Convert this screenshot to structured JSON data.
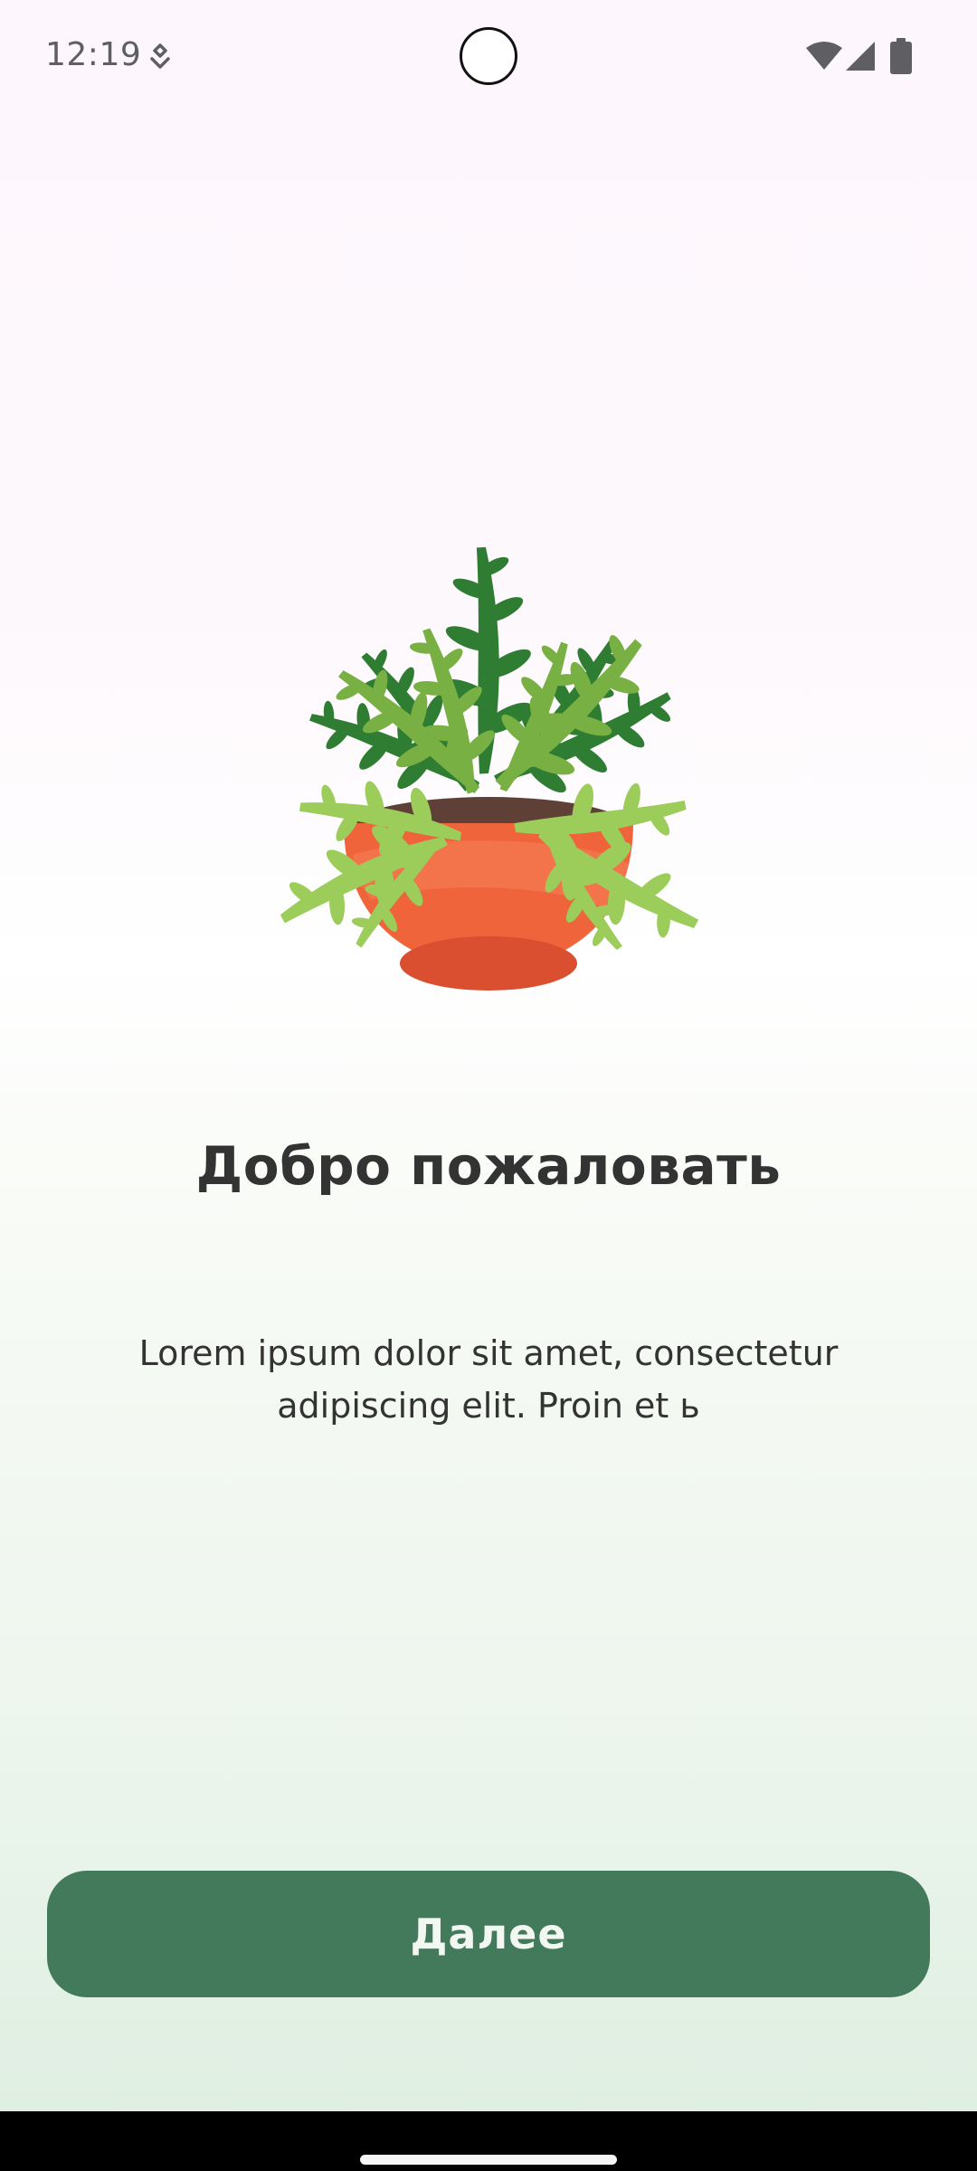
{
  "status_bar": {
    "time": "12:19",
    "icons": [
      "notification-icon",
      "wifi-icon",
      "signal-icon",
      "battery-icon"
    ]
  },
  "illustration": {
    "icon": "potted-plant-icon",
    "colors": {
      "pot": "#f0643c",
      "pot_base": "#d94f2f",
      "soil": "#5e4037",
      "leaf_dark": "#2e7d32",
      "leaf_mid": "#78b043",
      "leaf_light": "#9ccc5a"
    }
  },
  "onboarding": {
    "title": "Добро пожаловать",
    "description": "Lorem ipsum dolor sit amet, consectetur adipiscing elit. Proin et ь",
    "next_button_label": "Далее"
  },
  "colors": {
    "accent": "#427a5b",
    "text": "#333333"
  }
}
